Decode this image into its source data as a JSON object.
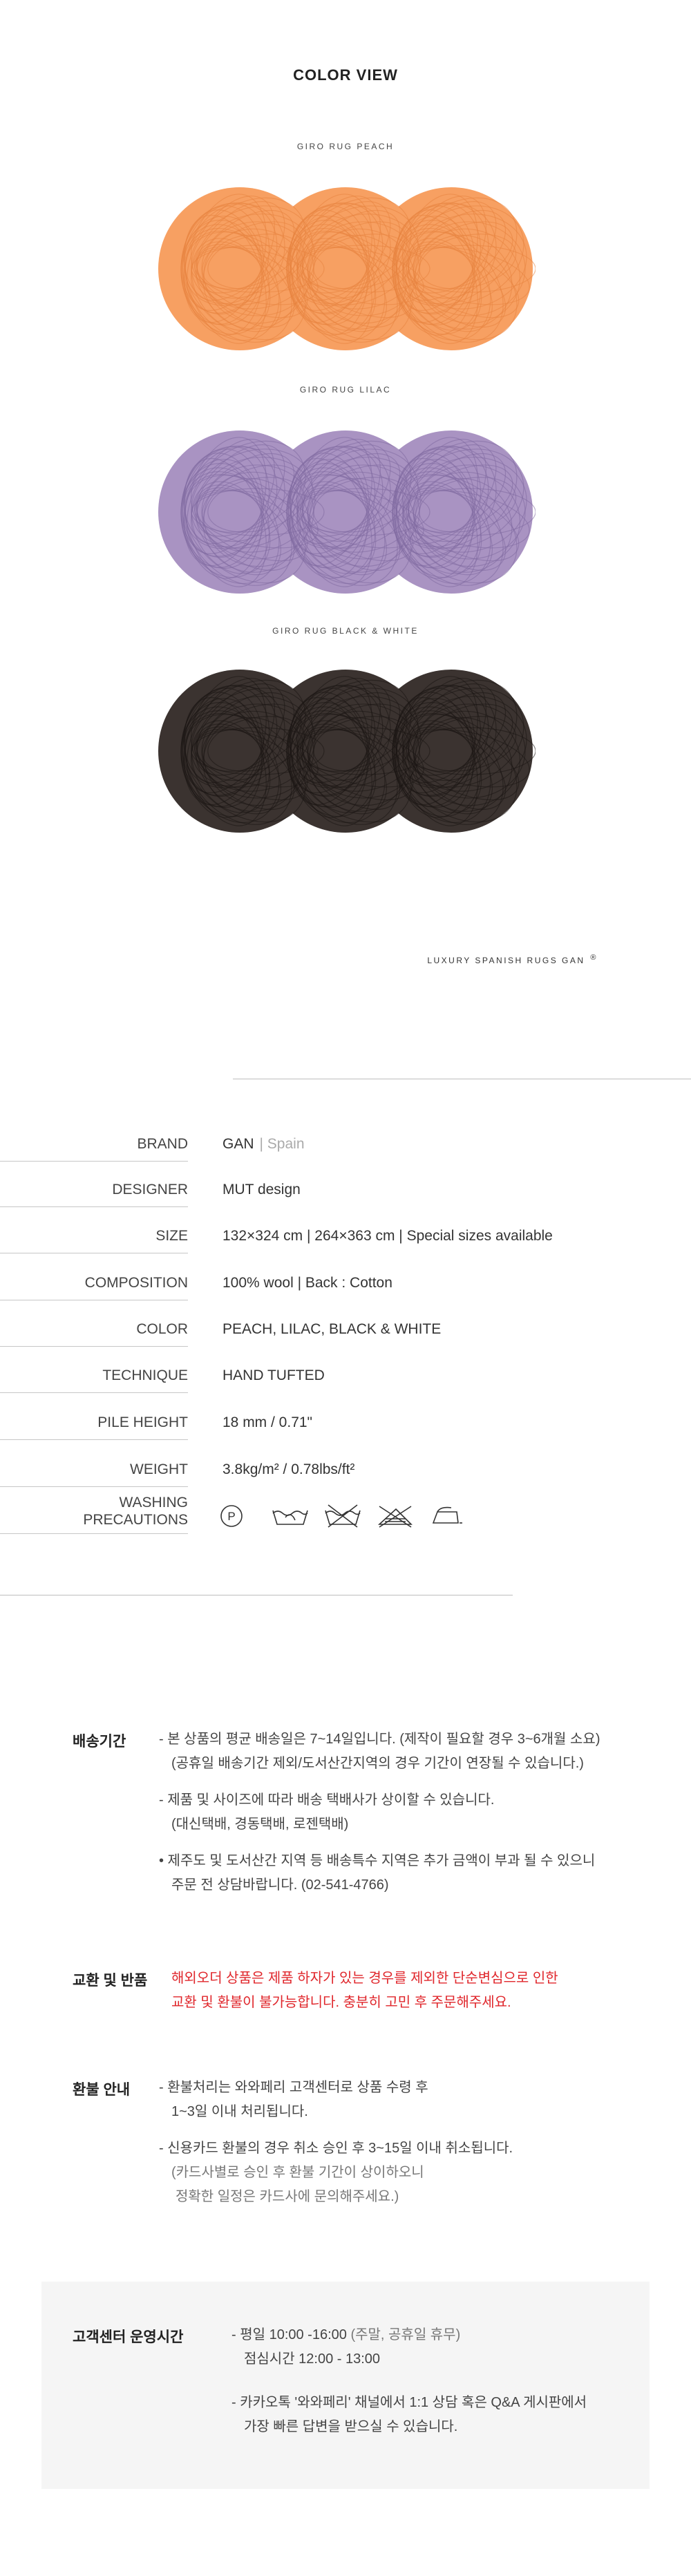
{
  "color_view": {
    "title": "COLOR VIEW",
    "rugs": [
      {
        "label": "GIRO RUG PEACH",
        "color": "#f7a062",
        "stroke": "#e8843f"
      },
      {
        "label": "GIRO RUG LILAC",
        "color": "#a993c2",
        "stroke": "#7f6aa0"
      },
      {
        "label": "GIRO RUG BLACK & WHITE",
        "color": "#3b3330",
        "stroke": "#1c1614"
      }
    ],
    "brand_tag": "LUXURY SPANISH RUGS GAN",
    "brand_mark": "®"
  },
  "specs": [
    {
      "label": "BRAND",
      "value": "GAN",
      "value_extra": "| Spain"
    },
    {
      "label": "DESIGNER",
      "value": "MUT design"
    },
    {
      "label": "SIZE",
      "value": "132×324 cm | 264×363  cm | Special sizes available"
    },
    {
      "label": "COMPOSITION",
      "value": "100% wool  |  Back : Cotton"
    },
    {
      "label": "COLOR",
      "value": "PEACH, LILAC, BLACK & WHITE"
    },
    {
      "label": "TECHNIQUE",
      "value": "HAND TUFTED"
    },
    {
      "label": "PILE HEIGHT",
      "value": "18 mm / 0.71\""
    },
    {
      "label": "WEIGHT",
      "value": "3.8kg/m² / 0.78lbs/ft²"
    },
    {
      "label": "WASHING",
      "label2": "PRECAUTIONS",
      "icons": [
        "dry-clean-p-icon",
        "hand-wash-icon",
        "no-wash-icon",
        "no-tumble-dry-icon",
        "iron-icon"
      ],
      "icon_text": "P"
    }
  ],
  "shipping": {
    "title": "배송기간",
    "lines": [
      "- 본 상품의 평균 배송일은 7~14일입니다. (제작이 필요할 경우 3~6개월 소요)",
      "(공휴일 배송기간 제외/도서산간지역의 경우 기간이 연장될 수 있습니다.)",
      "- 제품 및 사이즈에 따라 배송 택배사가 상이할 수 있습니다.",
      "(대신택배, 경동택배, 로젠택배)",
      "• 제주도 및 도서산간 지역 등 배송특수 지역은 추가 금액이 부과 될 수 있으니",
      "주문 전 상담바랍니다. (02-541-4766)"
    ]
  },
  "exchange": {
    "title": "교환 및 반품",
    "lines": [
      "해외오더 상품은 제품 하자가 있는 경우를 제외한 단순변심으로 인한",
      "교환 및 환불이 불가능합니다. 충분히 고민 후 주문해주세요."
    ]
  },
  "refund": {
    "title": "환불 안내",
    "lines": [
      "- 환불처리는 와와페리 고객센터로 상품 수령 후",
      "1~3일 이내 처리됩니다.",
      "- 신용카드 환불의 경우 취소 승인 후 3~15일 이내 취소됩니다.",
      "(카드사별로 승인 후 환불 기간이 상이하오니",
      "정확한 일정은 카드사에 문의해주세요.)"
    ]
  },
  "customer_center": {
    "title": "고객센터 운영시간",
    "hours": "- 평일  10:00 -16:00",
    "hours_note": "(주말, 공휴일 휴무)",
    "lunch": "점심시간  12:00 - 13:00",
    "kakao_1": "- 카카오톡 '와와페리' 채널에서 1:1 상담 혹은 Q&A 게시판에서",
    "kakao_2": "가장 빠른 답변을 받으실 수 있습니다."
  }
}
